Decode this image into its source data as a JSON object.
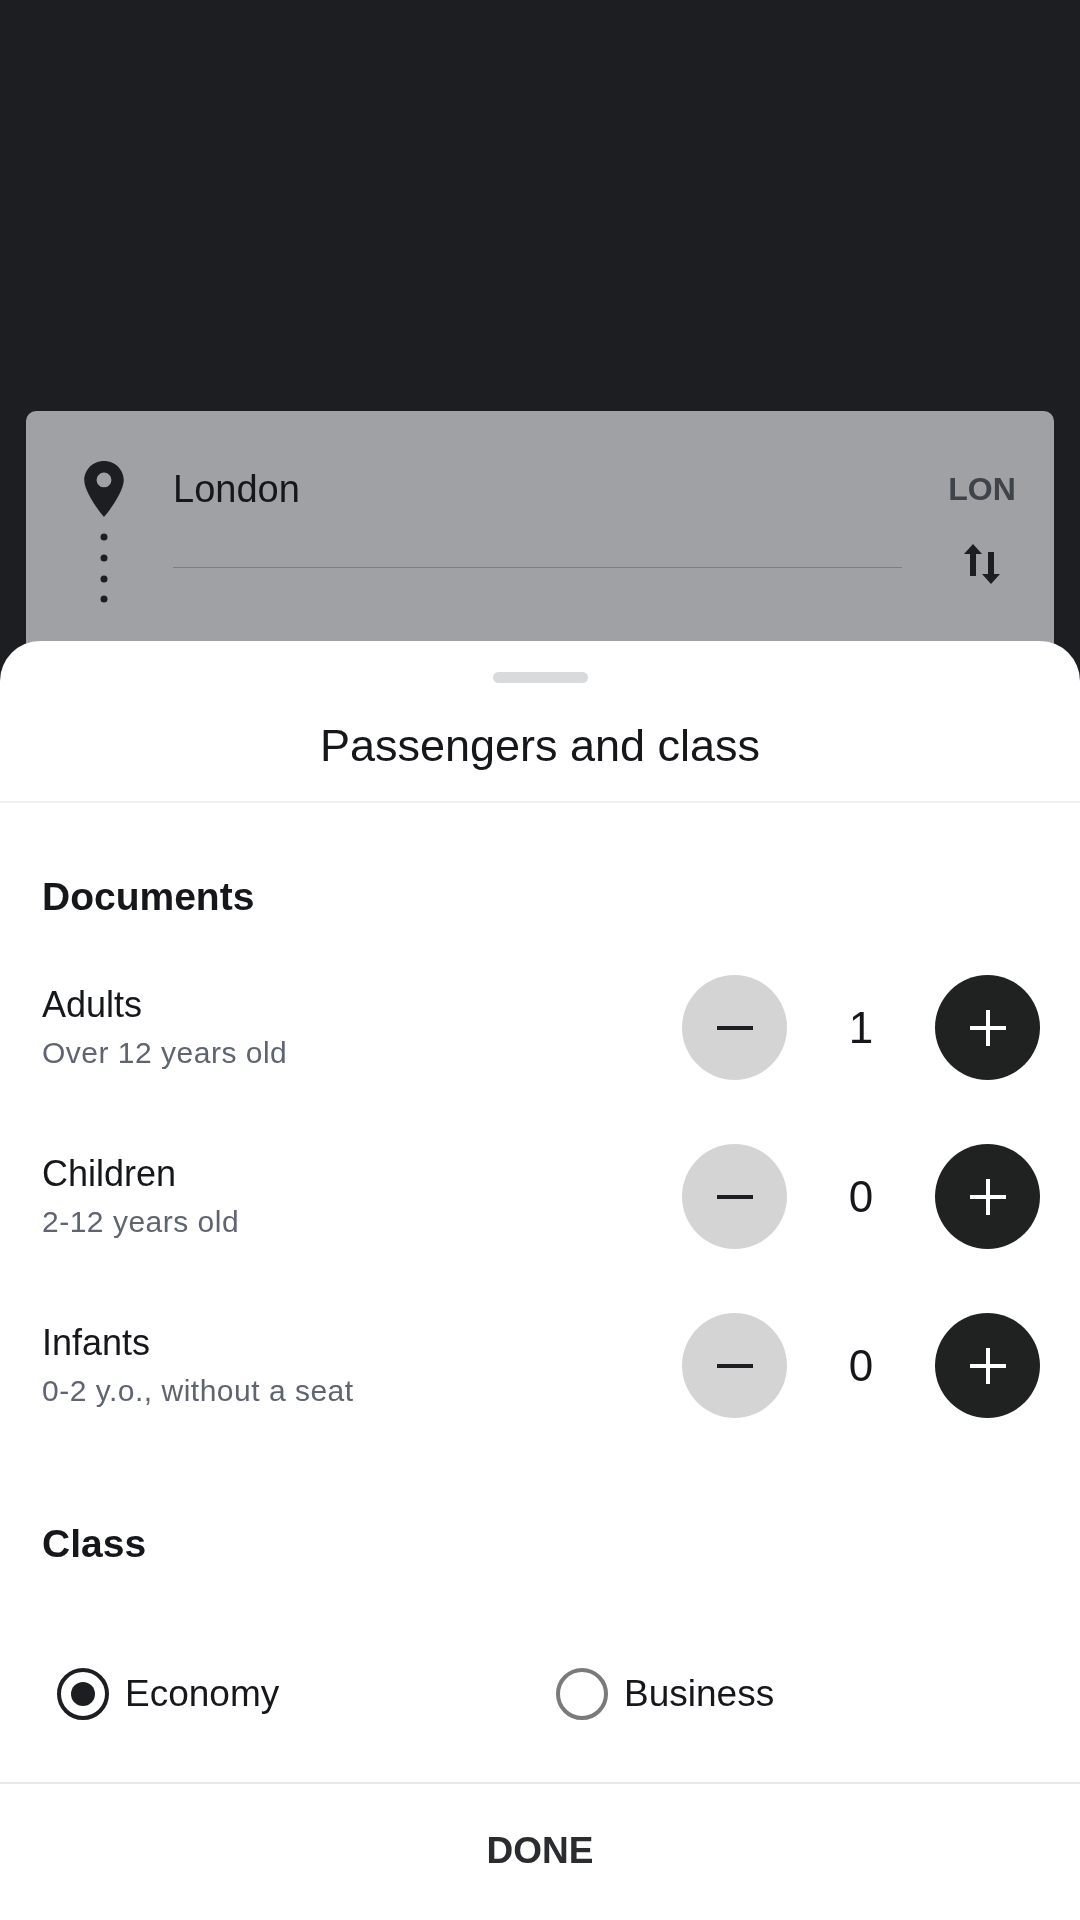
{
  "route": {
    "origin": {
      "city": "London",
      "code": "LON"
    }
  },
  "sheet": {
    "title": "Passengers and class",
    "documents": {
      "heading": "Documents",
      "counters": [
        {
          "label": "Adults",
          "note": "Over 12 years old",
          "value": "1",
          "can_decrease": false,
          "can_increase": true
        },
        {
          "label": "Children",
          "note": "2-12 years old",
          "value": "0",
          "can_decrease": false,
          "can_increase": true
        },
        {
          "label": "Infants",
          "note": "0-2 y.o., without a seat",
          "value": "0",
          "can_decrease": false,
          "can_increase": true
        }
      ]
    },
    "class": {
      "heading": "Class",
      "options": [
        {
          "label": "Economy",
          "selected": true
        },
        {
          "label": "Business",
          "selected": false
        }
      ]
    },
    "done_button": "DONE"
  }
}
